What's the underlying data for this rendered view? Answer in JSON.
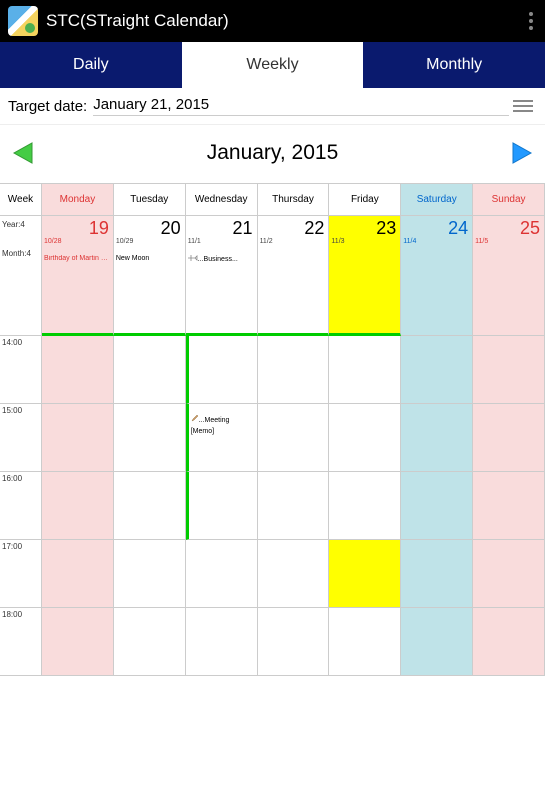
{
  "titlebar": {
    "title": "STC(STraight Calendar)"
  },
  "tabs": {
    "daily": "Daily",
    "weekly": "Weekly",
    "monthly": "Monthly"
  },
  "target": {
    "label": "Target date:",
    "value": "January 21, 2015"
  },
  "month": {
    "title": "January, 2015"
  },
  "headers": {
    "week": "Week",
    "mon": "Monday",
    "tue": "Tuesday",
    "wed": "Wednesday",
    "thu": "Thursday",
    "fri": "Friday",
    "sat": "Saturday",
    "sun": "Sunday"
  },
  "rowlabels": {
    "year": "Year:4",
    "month": "Month:4",
    "t14": "14:00",
    "t15": "15:00",
    "t16": "16:00",
    "t17": "17:00",
    "t18": "18:00"
  },
  "days": {
    "mon": {
      "num": "19",
      "alt": "10/28",
      "ev": "Birthday of Martin Lu..."
    },
    "tue": {
      "num": "20",
      "alt": "10/29",
      "ev": "New Moon"
    },
    "wed": {
      "num": "21",
      "alt": "11/1",
      "ev": "...Business..."
    },
    "thu": {
      "num": "22",
      "alt": "11/2"
    },
    "fri": {
      "num": "23",
      "alt": "11/3"
    },
    "sat": {
      "num": "24",
      "alt": "11/4"
    },
    "sun": {
      "num": "25",
      "alt": "11/5"
    }
  },
  "slot15": {
    "meeting": "...Meeting",
    "memo": "[Memo]"
  }
}
